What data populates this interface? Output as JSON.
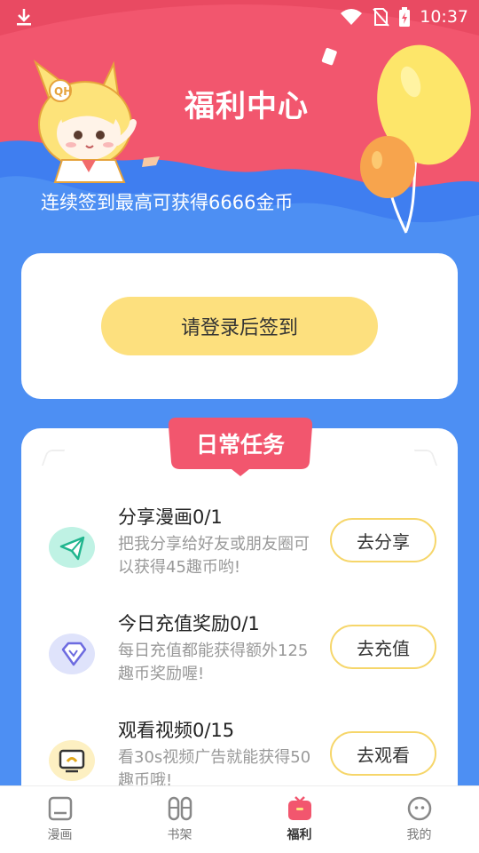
{
  "status_bar": {
    "time": "10:37"
  },
  "header": {
    "title": "福利中心",
    "subtitle": "连续签到最高可获得6666金币"
  },
  "login": {
    "button_label": "请登录后签到"
  },
  "tasks_section": {
    "title": "日常任务",
    "items": [
      {
        "title": "分享漫画0/1",
        "desc": "把我分享给好友或朋友圈可以获得45趣币哟!",
        "button": "去分享",
        "icon": "paper-plane-icon",
        "icon_bg": "#bff2e4",
        "icon_color": "#20b58e"
      },
      {
        "title": "今日充值奖励0/1",
        "desc": "每日充值都能获得额外125趣币奖励喔!",
        "button": "去充值",
        "icon": "diamond-icon",
        "icon_bg": "#dfe3fb",
        "icon_color": "#6d6be0"
      },
      {
        "title": "观看视频0/15",
        "desc": "看30s视频广告就能获得50趣币哦!",
        "button": "去观看",
        "icon": "video-tv-icon",
        "icon_bg": "#fdf0c2",
        "icon_color": "#e3a91e"
      }
    ]
  },
  "bottom_nav": {
    "items": [
      {
        "label": "漫画",
        "icon": "comic-icon"
      },
      {
        "label": "书架",
        "icon": "bookshelf-icon"
      },
      {
        "label": "福利",
        "icon": "gift-icon",
        "active": true
      },
      {
        "label": "我的",
        "icon": "profile-icon"
      }
    ]
  },
  "colors": {
    "header_pink": "#f2566e",
    "page_blue": "#4d8ff3",
    "login_button": "#fde07e",
    "task_button_border": "#f6d66a",
    "nav_active": "#f2566e"
  }
}
